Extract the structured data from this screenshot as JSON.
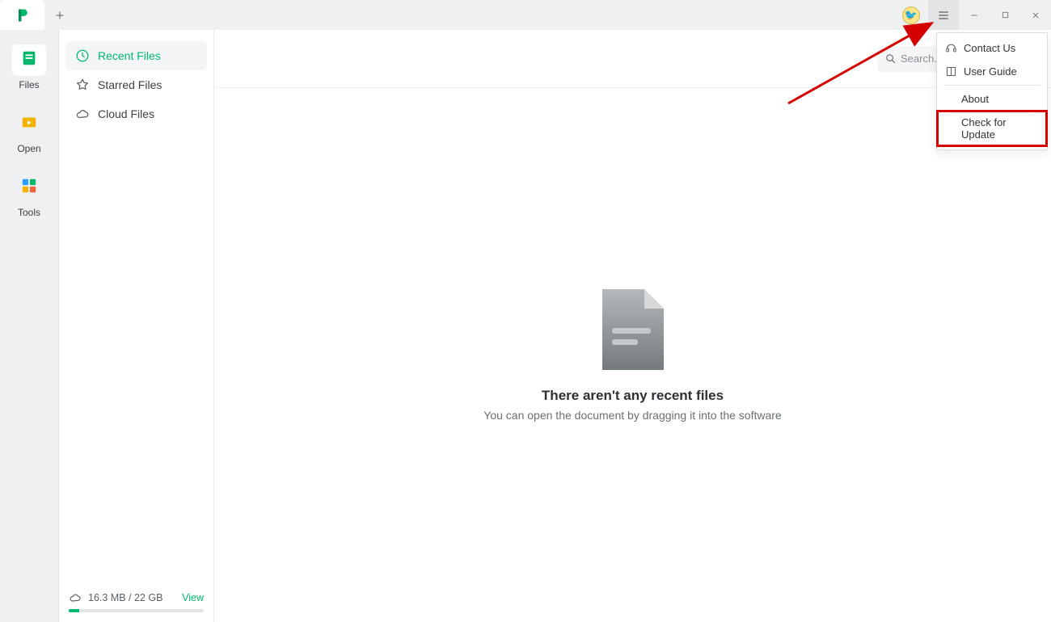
{
  "leftbar": {
    "items": [
      {
        "label": "Files"
      },
      {
        "label": "Open"
      },
      {
        "label": "Tools"
      }
    ]
  },
  "sidebar": {
    "items": [
      {
        "label": "Recent Files"
      },
      {
        "label": "Starred Files"
      },
      {
        "label": "Cloud Files"
      }
    ],
    "storage_text": "16.3 MB / 22 GB",
    "view_label": "View"
  },
  "toolbar": {
    "search_placeholder": "Search..."
  },
  "empty": {
    "title": "There aren't any recent files",
    "subtitle": "You can open the document by dragging it into the software"
  },
  "menu": {
    "items": [
      {
        "label": "Contact Us",
        "icon": "headset"
      },
      {
        "label": "User Guide",
        "icon": "book"
      },
      {
        "label": "About",
        "plain": true
      },
      {
        "label": "Check for Update",
        "plain": true,
        "highlight": true
      }
    ]
  },
  "avatar_emoji": "🐦"
}
